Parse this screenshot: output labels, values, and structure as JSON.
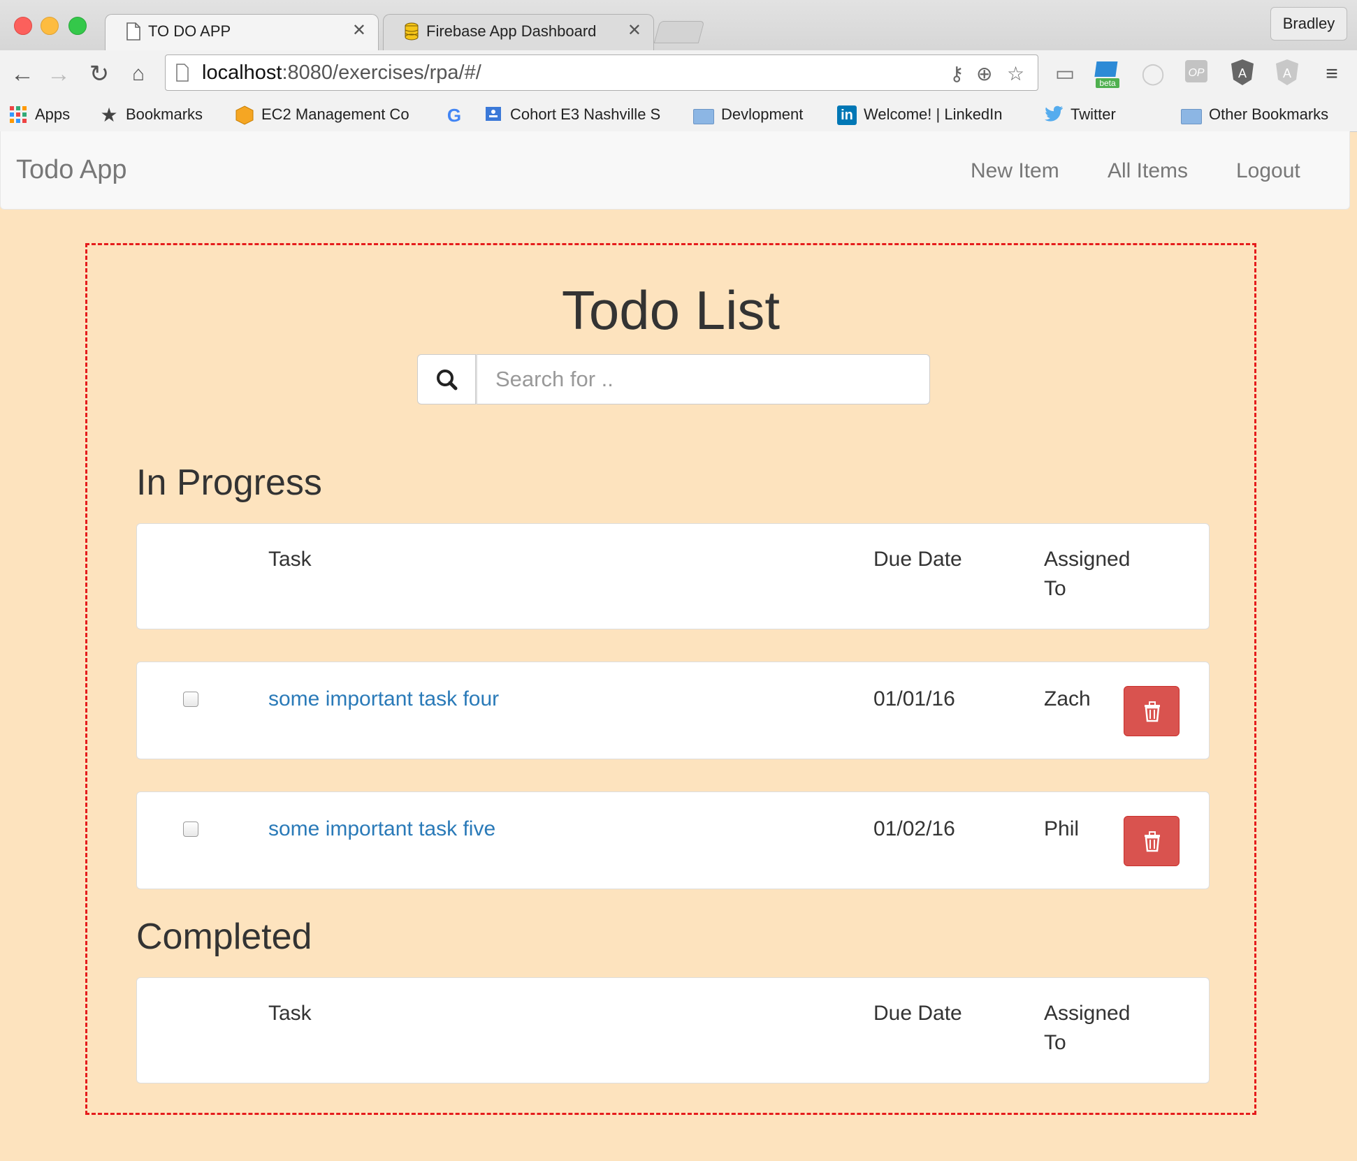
{
  "browser": {
    "tabs": [
      {
        "title": "TO DO APP",
        "active": true
      },
      {
        "title": "Firebase App Dashboard",
        "active": false
      }
    ],
    "profile_name": "Bradley",
    "url_host": "localhost",
    "url_rest": ":8080/exercises/rpa/#/",
    "bookmarks": [
      {
        "label": "Apps",
        "icon": "apps-grid-icon"
      },
      {
        "label": "Bookmarks",
        "icon": "star-icon"
      },
      {
        "label": "EC2 Management Co",
        "icon": "aws-box-icon"
      },
      {
        "label": "",
        "icon": "google-icon"
      },
      {
        "label": "Cohort E3 Nashville S",
        "icon": "classroom-icon"
      },
      {
        "label": "Devlopment",
        "icon": "folder-icon"
      },
      {
        "label": "Welcome! | LinkedIn",
        "icon": "linkedin-icon"
      },
      {
        "label": "Twitter",
        "icon": "twitter-icon"
      },
      {
        "label": "Other Bookmarks",
        "icon": "folder-icon"
      }
    ],
    "extension_badge": "beta"
  },
  "navbar": {
    "brand": "Todo App",
    "links": [
      "New Item",
      "All Items",
      "Logout"
    ]
  },
  "main": {
    "title": "Todo List",
    "search_placeholder": "Search for ..",
    "in_progress": {
      "heading": "In Progress",
      "header": {
        "task": "Task",
        "due": "Due Date",
        "assigned": "Assigned To"
      },
      "rows": [
        {
          "task": "some important task four",
          "due": "01/01/16",
          "assigned": "Zach",
          "done": false
        },
        {
          "task": "some important task five",
          "due": "01/02/16",
          "assigned": "Phil",
          "done": false
        }
      ]
    },
    "completed": {
      "heading": "Completed",
      "header": {
        "task": "Task",
        "due": "Due Date",
        "assigned": "Assigned To"
      },
      "rows": []
    }
  },
  "colors": {
    "page_background": "#fde3be",
    "frame_border": "#e51c1c",
    "link": "#2a7ab8",
    "delete_button": "#d9534f"
  }
}
